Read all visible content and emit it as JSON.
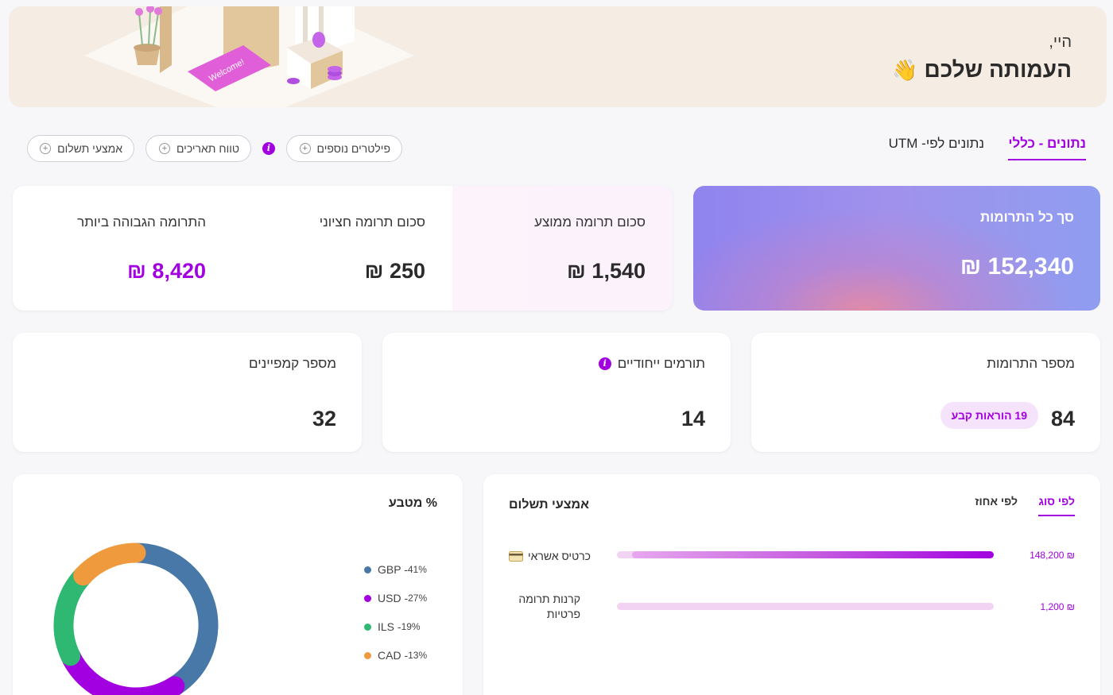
{
  "banner": {
    "greeting": "היי,",
    "org_name": "העמותה שלכם",
    "emoji": "👋",
    "welcome_mat": "Welcome!"
  },
  "tabs": [
    {
      "label": "נתונים - כללי",
      "active": true
    },
    {
      "label": "נתונים לפי- UTM",
      "active": false
    }
  ],
  "filters": {
    "more_filters": "פילטרים נוספים",
    "info_icon": "i",
    "date_range": "טווח תאריכים",
    "payment_methods": "אמצעי תשלום",
    "plus": "+"
  },
  "stats": {
    "total": {
      "label": "סך כל התרומות",
      "value": "152,340 ₪"
    },
    "average": {
      "label": "סכום תרומה ממוצע",
      "value": "1,540 ₪"
    },
    "median": {
      "label": "סכום תרומה חציוני",
      "value": "250 ₪"
    },
    "highest": {
      "label": "התרומה הגבוהה ביותר",
      "value": "8,420 ₪"
    },
    "count": {
      "label": "מספר התרומות",
      "value": "84",
      "badge": "19 הוראות קבע"
    },
    "unique_donors": {
      "label": "תורמים ייחודיים",
      "value": "14",
      "info_icon": "i"
    },
    "campaigns": {
      "label": "מספר קמפיינים",
      "value": "32"
    }
  },
  "payment_methods": {
    "title": "אמצעי תשלום",
    "tabs": [
      {
        "label": "לפי סוג",
        "active": true
      },
      {
        "label": "לפי אחוז",
        "active": false
      }
    ],
    "rows": [
      {
        "label": "כרטיס אשראי",
        "icon": "credit-card-icon",
        "amount": "₪ 148,200",
        "fraction": 0.99
      },
      {
        "label": "קרנות תרומה פרטיות",
        "icon": "",
        "amount": "₪ 1,200",
        "fraction": 0.01
      }
    ]
  },
  "currency": {
    "title": "% מטבע",
    "legend": [
      {
        "label": "GBP - ",
        "pct": "41%",
        "color": "#4878a8",
        "value": 41
      },
      {
        "label": "USD - ",
        "pct": "27%",
        "color": "#a200e0",
        "value": 27
      },
      {
        "label": "ILS - ",
        "pct": "19%",
        "color": "#2eb872",
        "value": 19
      },
      {
        "label": "CAD - ",
        "pct": "13%",
        "color": "#f09a3e",
        "value": 13
      }
    ]
  },
  "colors": {
    "accent": "#a200e0"
  }
}
